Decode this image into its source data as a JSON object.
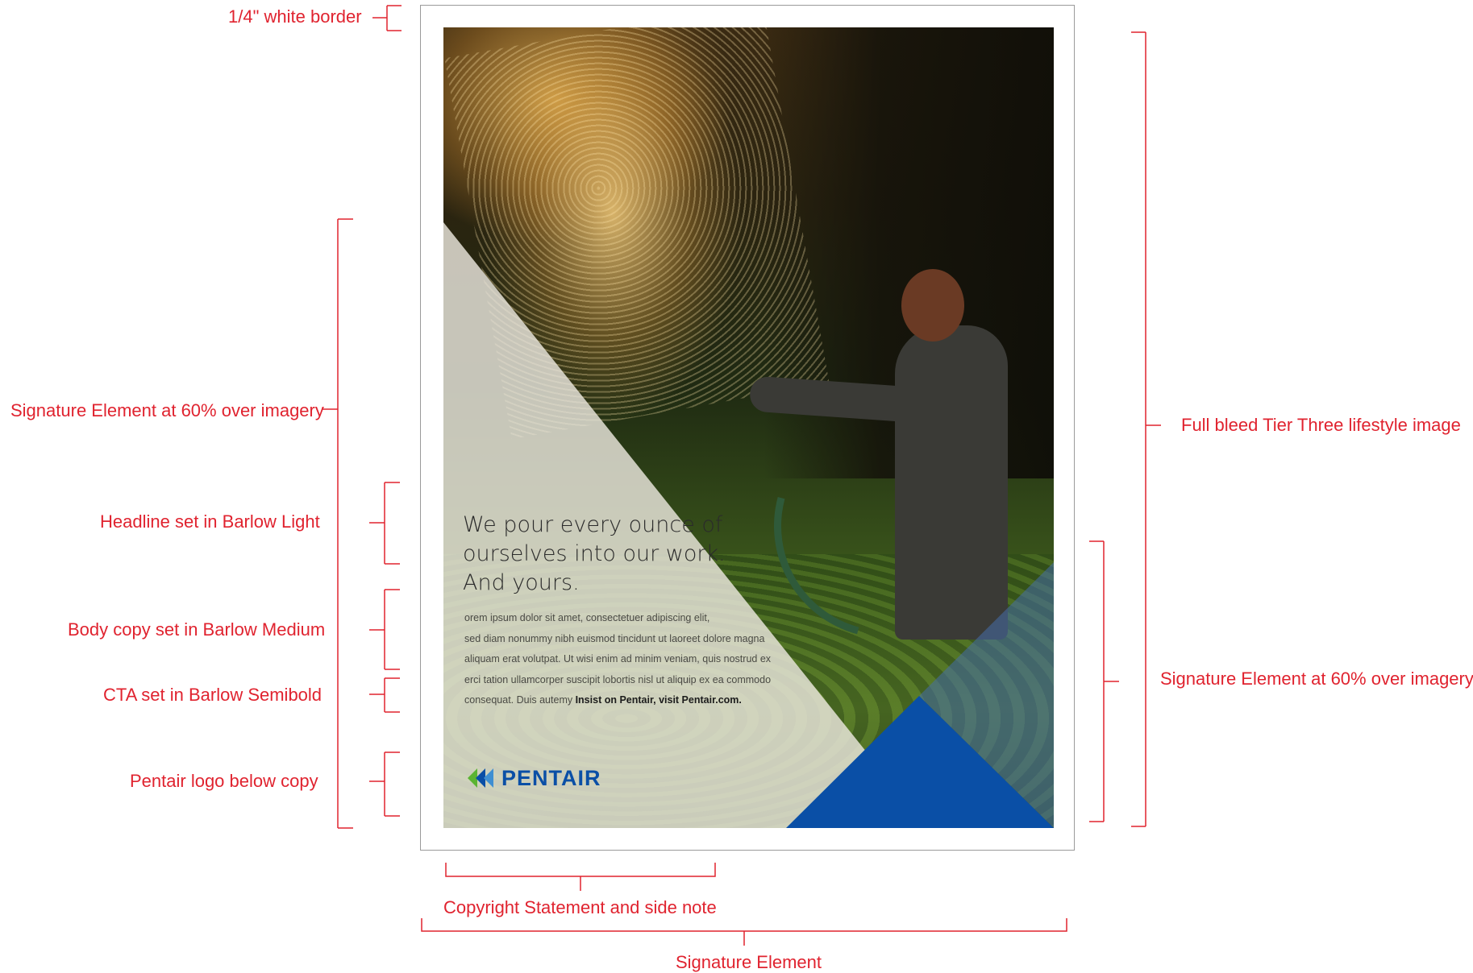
{
  "annotations": {
    "border": "1/4\" white border",
    "signature_overlay_left": "Signature Element at 60% over imagery",
    "headline": "Headline set in Barlow Light",
    "body": "Body copy set in Barlow Medium",
    "cta": "CTA set in Barlow Semibold",
    "logo": "Pentair logo below copy",
    "full_bleed": "Full bleed Tier Three lifestyle image",
    "signature_overlay_right": "Signature Element at 60% over imagery",
    "copyright": "Copyright Statement and side note",
    "signature_bottom": "Signature Element"
  },
  "ad": {
    "headline": [
      "We pour every ounce of",
      "ourselves into our work.",
      "And yours."
    ],
    "body_lines": [
      "orem ipsum dolor sit amet, consectetuer adipiscing elit,",
      "sed diam nonummy nibh euismod tincidunt ut laoreet dolore magna",
      "aliquam erat volutpat. Ut wisi enim ad minim veniam, quis nostrud ex",
      "erci tation ullamcorper suscipit lobortis nisl ut aliquip ex ea commodo"
    ],
    "body_last_prefix": "consequat. Duis autemy ",
    "cta": "Insist on Pentair, visit Pentair.com.",
    "logo_text": "PENTAIR"
  },
  "colors": {
    "annotation": "#e0232f",
    "brand_blue": "#0a4fa6",
    "logo_green": "#5bb432"
  }
}
